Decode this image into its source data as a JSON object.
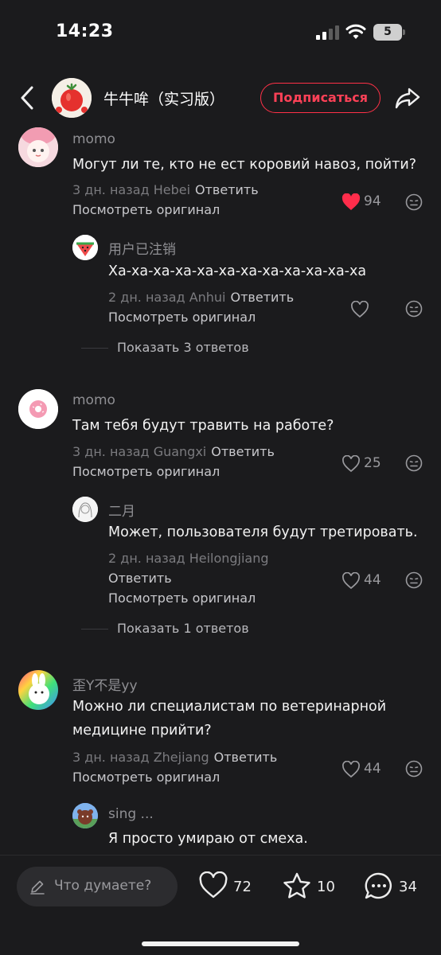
{
  "status_bar": {
    "time": "14:23",
    "battery": "5"
  },
  "header": {
    "channel_name": "牛牛哞（实习版）",
    "subscribe_label": "Подписаться"
  },
  "labels": {
    "reply": "Ответить",
    "view_original": "Посмотреть оригинал"
  },
  "comments": [
    {
      "author": "momo",
      "text": "Могут ли те, кто не ест коровий навоз, пойти?",
      "meta": "3 дн. назад Hebei",
      "likes": "94",
      "liked": true,
      "reply": {
        "author": "用户已注销",
        "text": "Ха-ха-ха-ха-ха-ха-ха-ха-ха-ха-ха-ха",
        "meta": "2 дн. назад Anhui",
        "likes": ""
      },
      "show_replies": "Показать 3 ответов"
    },
    {
      "author": "momo",
      "text": "Там тебя будут травить на работе?",
      "meta": "3 дн. назад Guangxi",
      "likes": "25",
      "reply": {
        "author": "二月",
        "text": "Может, пользователя будут третировать.",
        "meta": "2 дн. назад Heilongjiang",
        "likes": "44"
      },
      "show_replies": "Показать 1 ответов"
    },
    {
      "author": "歪Y不是yy",
      "text_lines": [
        "Можно ли специалистам по ветеринарной",
        "медицине прийти?"
      ],
      "meta": "3 дн. назад Zhejiang",
      "likes": "44",
      "reply": {
        "author": "sing ...",
        "text": "Я просто умираю от смеха."
      }
    }
  ],
  "bottom_bar": {
    "input_placeholder": "Что думаете?",
    "likes": "72",
    "favorites": "10",
    "comments": "34"
  },
  "colors": {
    "accent": "#ff3147",
    "background": "#1b1b1d",
    "liked_heart": "#ff2d4b"
  }
}
